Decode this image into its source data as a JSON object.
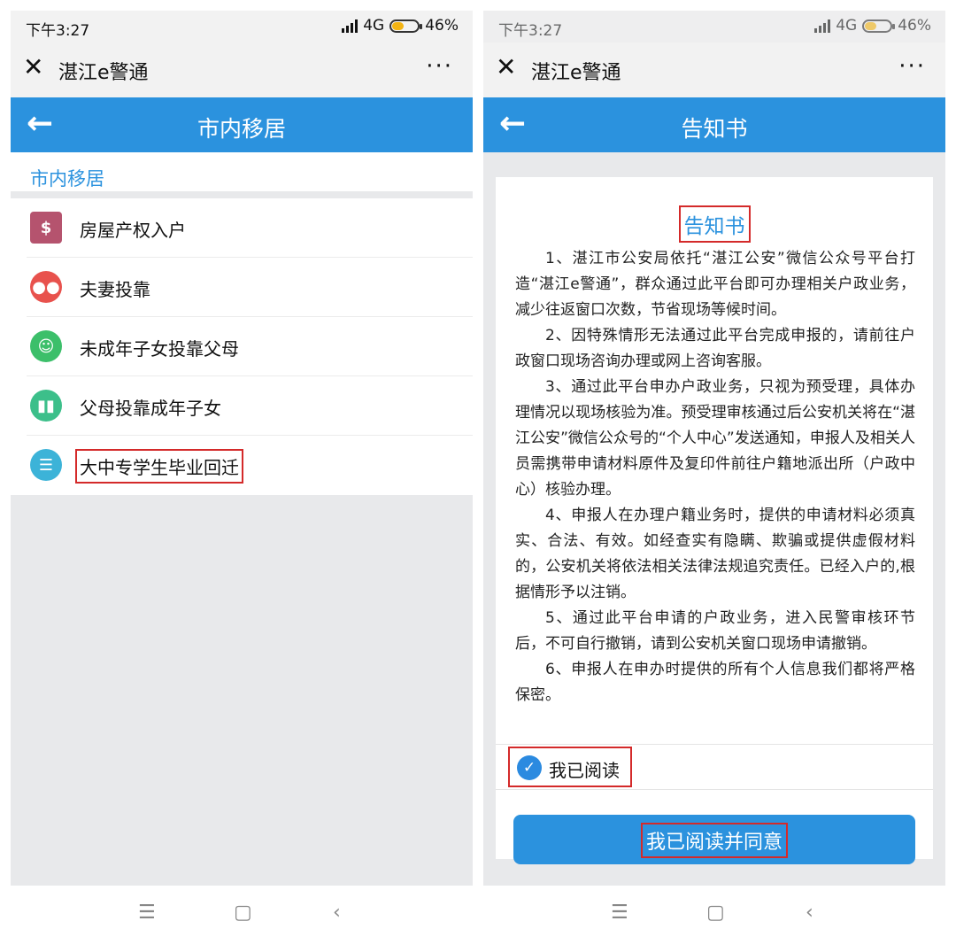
{
  "status": {
    "time": "下午3:27",
    "network": "4G",
    "battery": "46%",
    "battery_level": 0.46
  },
  "app": {
    "close_icon": "close-icon",
    "title": "湛江e警通",
    "more": "···"
  },
  "left": {
    "header_title": "市内移居",
    "back_icon": "arrow-left-icon",
    "section_label": "市内移居",
    "items": [
      {
        "label": "房屋产权入户",
        "icon": "house-dollar-icon",
        "color": "#b5536e"
      },
      {
        "label": "夫妻投靠",
        "icon": "couple-icon",
        "color": "#e8524d"
      },
      {
        "label": "未成年子女投靠父母",
        "icon": "child-icon",
        "color": "#3cbf6a"
      },
      {
        "label": "父母投靠成年子女",
        "icon": "parents-icon",
        "color": "#3cbf8a"
      },
      {
        "label": "大中专学生毕业回迁",
        "icon": "graduate-icon",
        "color": "#3cb3d8"
      }
    ]
  },
  "right": {
    "header_title": "告知书",
    "notice_title": "告知书",
    "paragraphs": [
      "1、湛江市公安局依托“湛江公安”微信公众号平台打造“湛江e警通”，群众通过此平台即可办理相关户政业务，减少往返窗口次数，节省现场等候时间。",
      "2、因特殊情形无法通过此平台完成申报的，请前往户政窗口现场咨询办理或网上咨询客服。",
      "3、通过此平台申办户政业务，只视为预受理，具体办理情况以现场核验为准。预受理审核通过后公安机关将在“湛江公安”微信公众号的“个人中心”发送通知，申报人及相关人员需携带申请材料原件及复印件前往户籍地派出所（户政中心）核验办理。",
      "4、申报人在办理户籍业务时，提供的申请材料必须真实、合法、有效。如经查实有隐瞒、欺骗或提供虚假材料的，公安机关将依法相关法律法规追究责任。已经入户的,根据情形予以注销。",
      "5、通过此平台申请的户政业务，进入民警审核环节后，不可自行撤销，请到公安机关窗口现场申请撤销。",
      "6、申报人在申办时提供的所有个人信息我们都将严格保密。"
    ],
    "read_label": "我已阅读",
    "agree_button": "我已阅读并同意"
  },
  "nav": {
    "menu": "☰",
    "home": "▢",
    "back": "‹"
  },
  "colors": {
    "accent": "#2b92de",
    "highlight": "#d42a2a"
  }
}
